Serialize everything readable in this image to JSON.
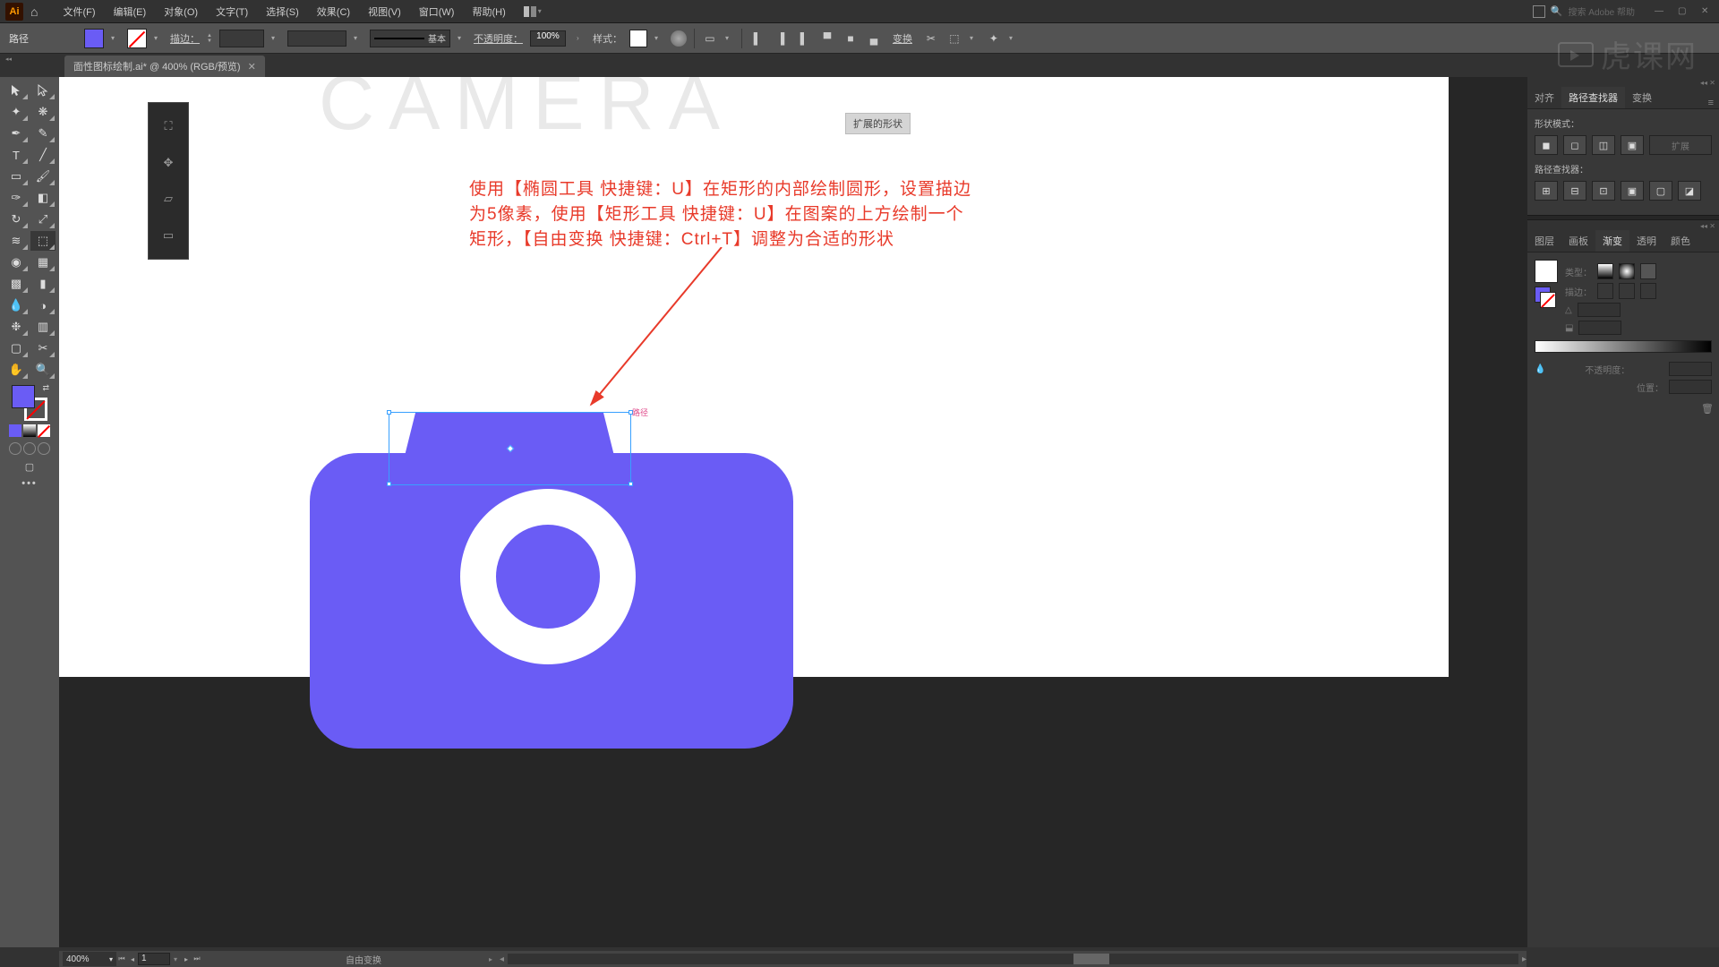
{
  "menubar": {
    "app_icon": "Ai",
    "menus": [
      "文件(F)",
      "编辑(E)",
      "对象(O)",
      "文字(T)",
      "选择(S)",
      "效果(C)",
      "视图(V)",
      "窗口(W)",
      "帮助(H)"
    ],
    "search_placeholder": "搜索 Adobe 帮助"
  },
  "controlbar": {
    "object_label": "路径",
    "stroke_label": "描边：",
    "stroke_width": "",
    "brush_label": "基本",
    "opacity_label": "不透明度：",
    "opacity_value": "100%",
    "style_label": "样式：",
    "transform_label": "变换"
  },
  "doctab": {
    "title": "面性图标绘制.ai* @ 400% (RGB/预览)"
  },
  "canvas": {
    "expand_chip": "扩展的形状",
    "path_label": "路径",
    "big_title": "CAMERA",
    "annotation_line1": "使用【椭圆工具 快捷键：U】在矩形的内部绘制圆形，设置描边",
    "annotation_line2": "为5像素，使用【矩形工具 快捷键：U】在图案的上方绘制一个",
    "annotation_line3": "矩形，【自由变换 快捷键：Ctrl+T】调整为合适的形状"
  },
  "statusbar": {
    "zoom": "400%",
    "page": "1",
    "status": "自由变换"
  },
  "right_panels": {
    "align_tabs": [
      "对齐",
      "路径查找器",
      "变换"
    ],
    "align_active": 1,
    "shape_mode_label": "形状模式：",
    "pathfinder_label": "路径查找器：",
    "expand_btn": "扩展",
    "grad_tabs": [
      "图层",
      "画板",
      "渐变",
      "透明",
      "颜色"
    ],
    "grad_active": 2,
    "type_label": "类型：",
    "stroke_label": "描边：",
    "opacity_label": "不透明度：",
    "position_label": "位置："
  },
  "watermark": "虎课网",
  "colors": {
    "accent": "#6a5cf5",
    "annotation": "#e83a2a"
  }
}
